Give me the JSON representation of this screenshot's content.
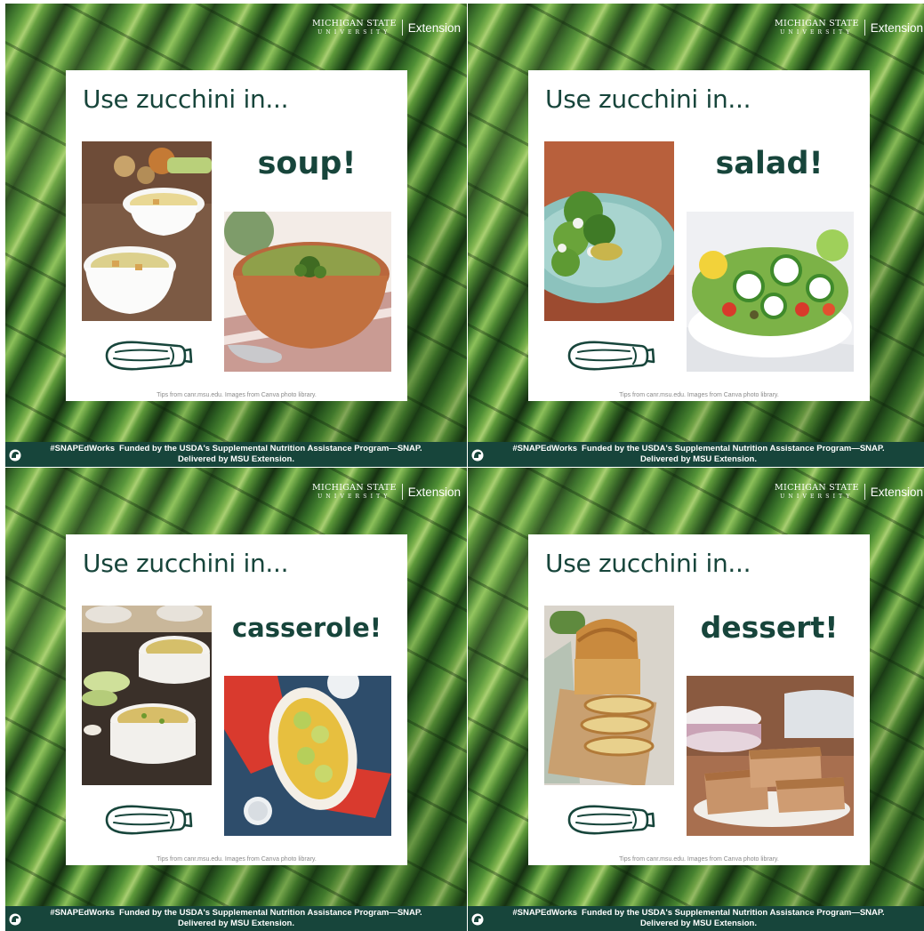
{
  "brand": {
    "msu_line1": "MICHIGAN STATE",
    "msu_line2": "UNIVERSITY",
    "extension": "Extension"
  },
  "panels": [
    {
      "headline": "Use zucchini in...",
      "word": "soup!"
    },
    {
      "headline": "Use zucchini in...",
      "word": "salad!"
    },
    {
      "headline": "Use zucchini in...",
      "word": "casserole!"
    },
    {
      "headline": "Use zucchini in...",
      "word": "dessert!"
    }
  ],
  "credits": "Tips from canr.msu.edu.  Images from Canva photo library.",
  "footer": {
    "hashtag": "#SNAPEdWorks",
    "line1": "Funded by the USDA's Supplemental Nutrition Assistance Program—SNAP.",
    "line2": "Delivered by MSU Extension."
  },
  "colors": {
    "brand_green": "#17453b",
    "card_bg": "#ffffff"
  }
}
